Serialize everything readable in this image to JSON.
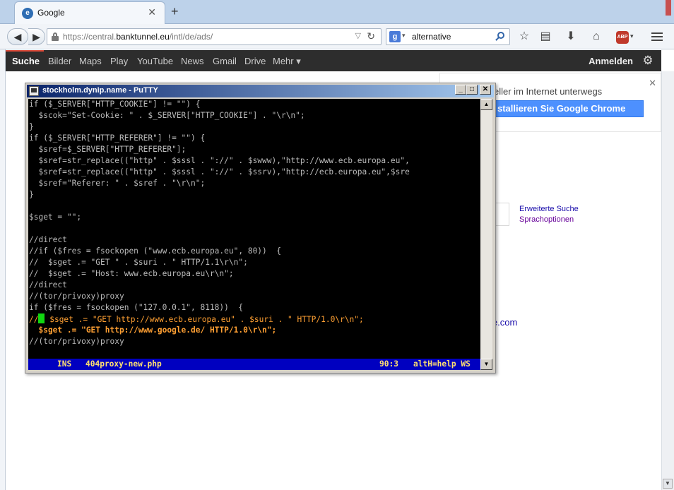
{
  "browser": {
    "tab_title": "Google",
    "tab_favicon": "e",
    "url_prefix": "https://central.",
    "url_domain": "banktunnel.eu",
    "url_path": "/intl/de/ads/",
    "search_value": "alternative",
    "abp_label": "ABP"
  },
  "gbar": {
    "items": [
      "Suche",
      "Bilder",
      "Maps",
      "Play",
      "YouTube",
      "News",
      "Gmail",
      "Drive",
      "Mehr ▾"
    ],
    "signin": "Anmelden"
  },
  "google": {
    "promo_text": "eller im Internet unterwegs",
    "promo_button": "stallieren Sie Google Chrome",
    "advanced_search": "Erweiterte Suche",
    "language_options": "Sprachoptionen",
    "domain_link": "le.com"
  },
  "putty": {
    "title": "stockholm.dynip.name - PuTTY",
    "lines": [
      "if ($_SERVER[\"HTTP_COOKIE\"] != \"\") {",
      "  $scok=\"Set-Cookie: \" . $_SERVER[\"HTTP_COOKIE\"] . \"\\r\\n\";",
      "}",
      "if ($_SERVER[\"HTTP_REFERER\"] != \"\") {",
      "  $sref=$_SERVER[\"HTTP_REFERER\"];",
      "  $sref=str_replace((\"http\" . $sssl . \"://\" . $swww),\"http://www.ecb.europa.eu\",",
      "  $sref=str_replace((\"http\" . $sssl . \"://\" . $ssrv),\"http://ecb.europa.eu\",$sre",
      "  $sref=\"Referer: \" . $sref . \"\\r\\n\";",
      "}",
      "",
      "$sget = \"\";",
      "",
      "//direct",
      "//if ($fres = fsockopen (\"www.ecb.europa.eu\", 80))  {",
      "//  $sget .= \"GET \" . $suri . \" HTTP/1.1\\r\\n\";",
      "//  $sget .= \"Host: www.ecb.europa.eu\\r\\n\";",
      "//direct",
      "//(tor/privoxy)proxy",
      "if ($fres = fsockopen (\"127.0.0.1\", 8118))  {"
    ],
    "cursor_prefix": "//",
    "cursor_line_rest": " $sget .= \"GET http://www.ecb.europa.eu\" . $suri . \" HTTP/1.0\\r\\n\";",
    "bold_line": "  $sget .= \"GET http://www.google.de/ HTTP/1.0\\r\\n\";",
    "last_line": "//(tor/privoxy)proxy",
    "status_mode": "INS",
    "status_file": "404proxy-new.php",
    "status_pos": "90:3",
    "status_help": "altH=help WS"
  },
  "colors": {
    "terminal_text": "#bbbbbb",
    "highlight_text": "#ffa033",
    "cursor": "#11d611",
    "status_bg": "#0000c0",
    "chrome_promo": "#4d90fe"
  }
}
